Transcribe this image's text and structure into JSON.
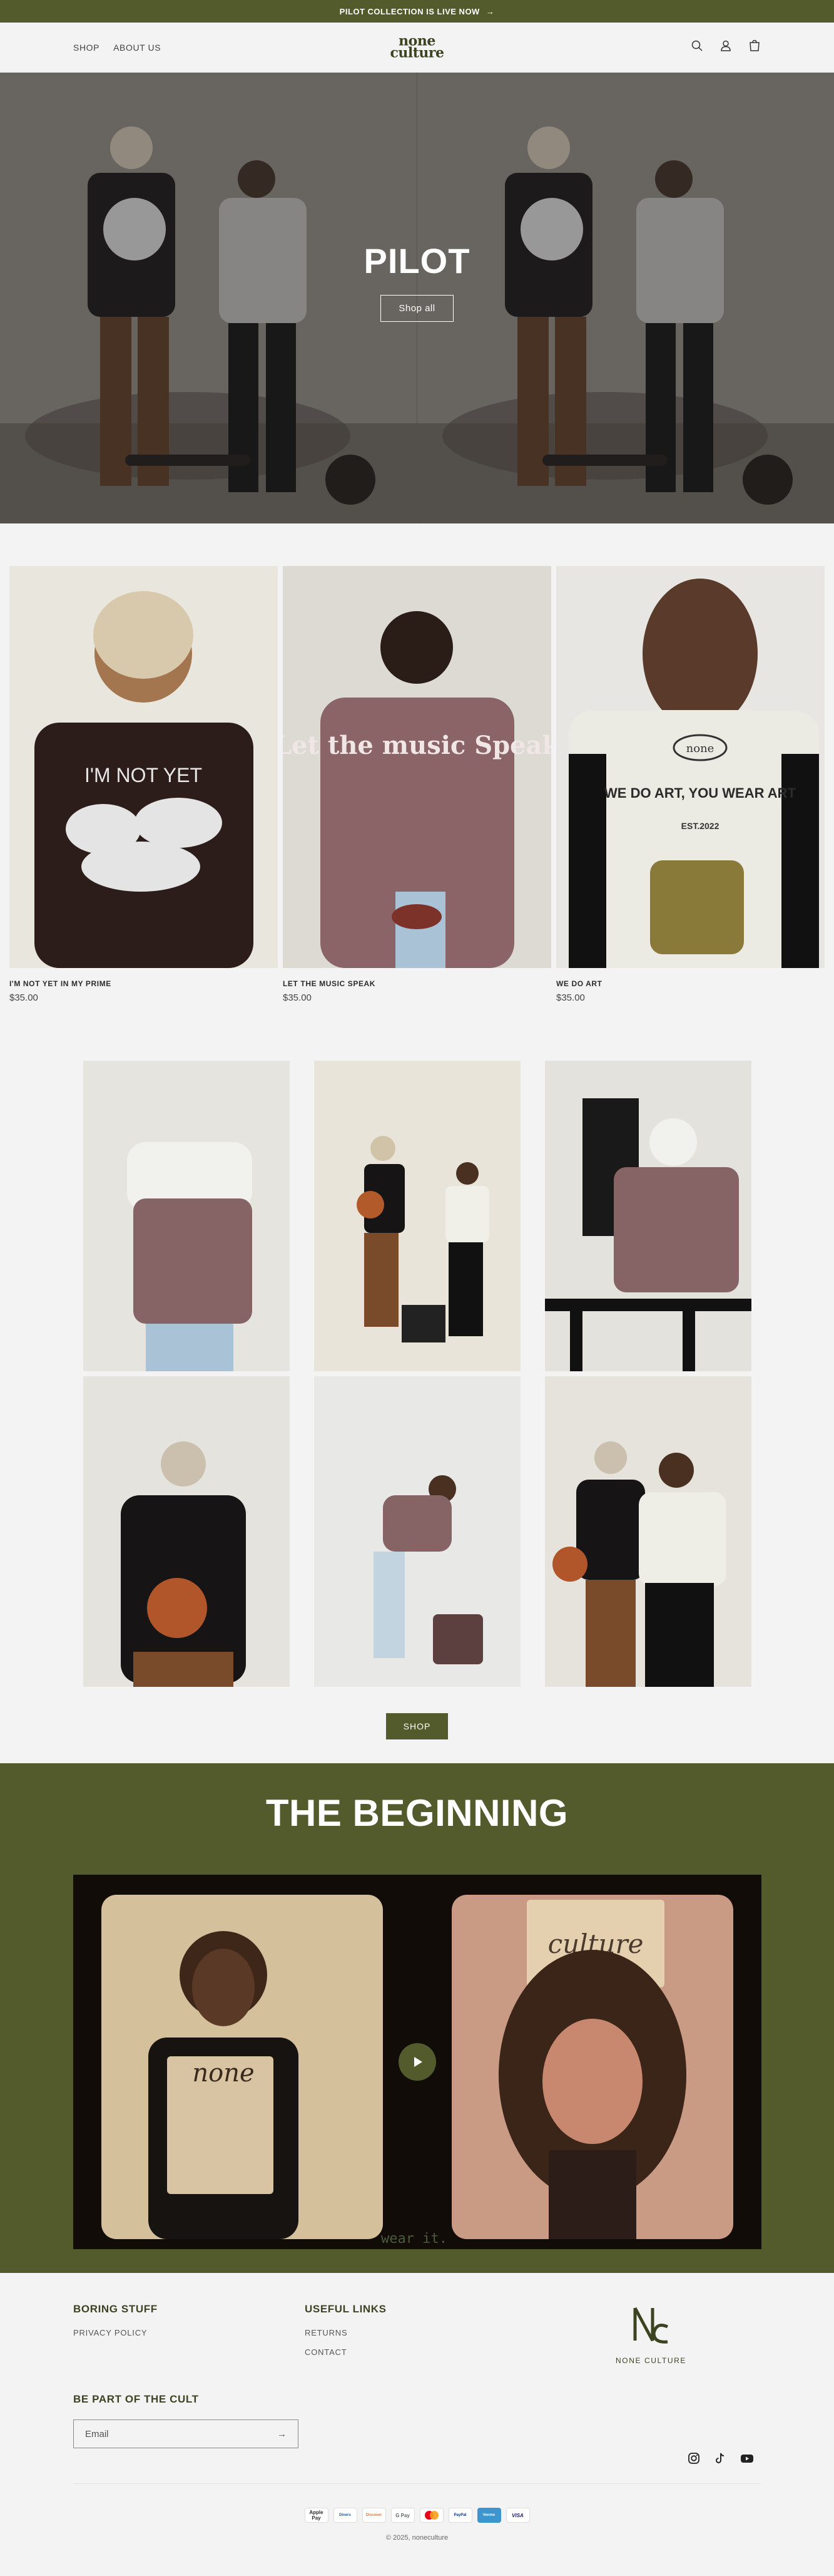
{
  "announcement": {
    "text": "PILOT COLLECTION IS LIVE NOW",
    "arrow": "→"
  },
  "header": {
    "nav": [
      "SHOP",
      "ABOUT US"
    ],
    "logo": {
      "line1": "none",
      "line2": "culture"
    },
    "icons": [
      "search-icon",
      "account-icon",
      "cart-icon"
    ]
  },
  "hero": {
    "title": "PILOT",
    "button": "Shop all"
  },
  "products": [
    {
      "title": "I'M NOT YET IN MY PRIME",
      "price": "$35.00",
      "shirt_text": "I'M NOT YET"
    },
    {
      "title": "LET THE MUSIC SPEAK",
      "price": "$35.00",
      "shirt_text": "Let the music Speak"
    },
    {
      "title": "WE DO ART",
      "price": "$35.00",
      "shirt_text": "WE DO ART, YOU WEAR ART",
      "shirt_sub": "EST.2022",
      "shirt_logo": "none"
    }
  ],
  "shop_button": "SHOP",
  "beginning": {
    "title": "THE BEGINNING",
    "video": {
      "sign_left": "none",
      "sign_right": "culture",
      "caption": "wear it."
    }
  },
  "footer": {
    "col1": {
      "title": "BORING STUFF",
      "links": [
        "PRIVACY POLICY"
      ]
    },
    "col2": {
      "title": "USEFUL LINKS",
      "links": [
        "RETURNS",
        "CONTACT"
      ]
    },
    "brand": {
      "name": "NONE CULTURE"
    },
    "cult": {
      "title": "BE PART OF THE CULT",
      "email_placeholder": "Email",
      "arrow": "→"
    },
    "socials": [
      "instagram-icon",
      "tiktok-icon",
      "youtube-icon"
    ],
    "payments": [
      "Apple Pay",
      "Diners",
      "Discover",
      "G Pay",
      "Mastercard",
      "PayPal",
      "Venmo",
      "VISA"
    ],
    "copyright": "© 2025, noneculture"
  },
  "colors": {
    "brand": "#535b2c",
    "brand_dark": "#3c4320",
    "page_bg": "#f3f3f3"
  }
}
